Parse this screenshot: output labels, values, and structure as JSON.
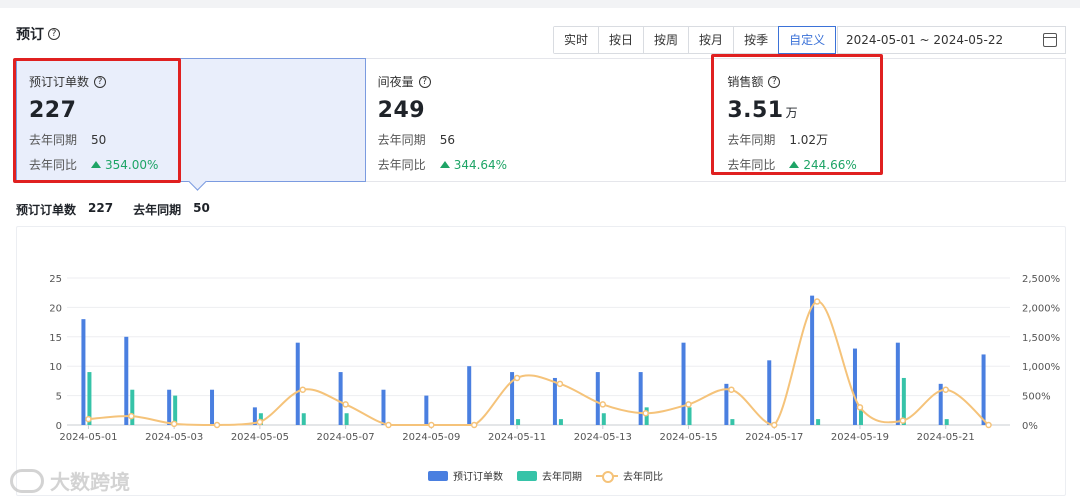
{
  "header": {
    "title": "预订",
    "help": "?",
    "segments": [
      "实时",
      "按日",
      "按周",
      "按月",
      "按季",
      "自定义"
    ],
    "active_segment": "自定义",
    "date_range": "2024-05-01 ~ 2024-05-22"
  },
  "cards": [
    {
      "label": "预订订单数",
      "value": "227",
      "unit": "",
      "ly_label": "去年同期",
      "ly_value": "50",
      "yoy_label": "去年同比",
      "yoy_value": "354.00%"
    },
    {
      "label": "间夜量",
      "value": "249",
      "unit": "",
      "ly_label": "去年同期",
      "ly_value": "56",
      "yoy_label": "去年同比",
      "yoy_value": "344.64%"
    },
    {
      "label": "销售额",
      "value": "3.51",
      "unit": "万",
      "ly_label": "去年同期",
      "ly_value": "1.02万",
      "yoy_label": "去年同比",
      "yoy_value": "244.66%"
    }
  ],
  "summary": {
    "label": "预订订单数",
    "value": "227",
    "ly_label": "去年同期",
    "ly_value": "50"
  },
  "colors": {
    "primary": "#4a7fe0",
    "teal": "#36c3a8",
    "line": "#f5c37a",
    "highlight": "#e02020"
  },
  "legend": [
    "预订订单数",
    "去年同期",
    "去年同比"
  ],
  "watermark": "大数跨境",
  "chart_data": {
    "type": "bar",
    "x": [
      "2024-05-01",
      "2024-05-02",
      "2024-05-03",
      "2024-05-04",
      "2024-05-05",
      "2024-05-06",
      "2024-05-07",
      "2024-05-08",
      "2024-05-09",
      "2024-05-10",
      "2024-05-11",
      "2024-05-12",
      "2024-05-13",
      "2024-05-14",
      "2024-05-15",
      "2024-05-16",
      "2024-05-17",
      "2024-05-18",
      "2024-05-19",
      "2024-05-20",
      "2024-05-21",
      "2024-05-22"
    ],
    "x_tick_labels": [
      "2024-05-01",
      "2024-05-03",
      "2024-05-05",
      "2024-05-07",
      "2024-05-09",
      "2024-05-11",
      "2024-05-13",
      "2024-05-15",
      "2024-05-17",
      "2024-05-19",
      "2024-05-21"
    ],
    "series": [
      {
        "name": "预订订单数",
        "type": "bar",
        "axis": "left",
        "values": [
          18,
          15,
          6,
          6,
          3,
          14,
          9,
          6,
          5,
          10,
          9,
          8,
          9,
          9,
          14,
          7,
          11,
          22,
          13,
          14,
          7,
          12
        ]
      },
      {
        "name": "去年同期",
        "type": "bar",
        "axis": "left",
        "values": [
          9,
          6,
          5,
          0,
          2,
          2,
          2,
          0,
          0,
          0,
          1,
          1,
          2,
          3,
          3,
          1,
          0,
          1,
          3,
          8,
          1,
          0
        ]
      },
      {
        "name": "去年同比",
        "type": "line",
        "axis": "right",
        "values": [
          100,
          150,
          20,
          0,
          50,
          600,
          350,
          0,
          0,
          0,
          800,
          700,
          350,
          200,
          350,
          600,
          0,
          2100,
          300,
          75,
          600,
          0
        ]
      }
    ],
    "y_left": {
      "ticks": [
        0,
        5,
        10,
        15,
        20,
        25
      ],
      "range": [
        0,
        25
      ]
    },
    "y_right": {
      "ticks": [
        "0%",
        "500%",
        "1,000%",
        "1,500%",
        "2,000%",
        "2,500%"
      ],
      "range": [
        0,
        2500
      ]
    },
    "grid": true,
    "legend_position": "bottom-center"
  }
}
